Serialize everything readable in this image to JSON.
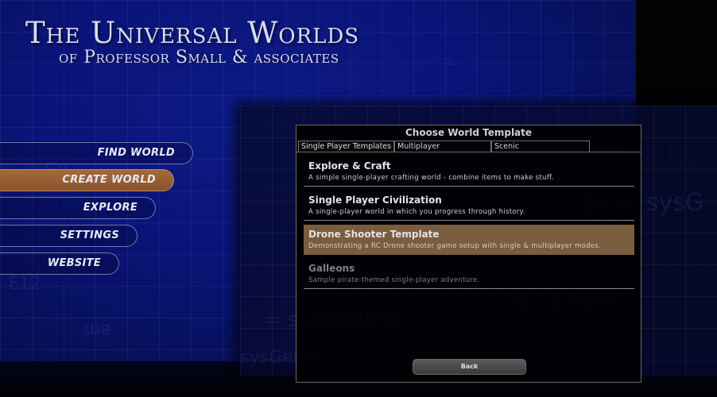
{
  "header": {
    "title_line1": "The Universal Worlds",
    "title_line2": "of Professor Small & associates"
  },
  "main_menu": {
    "items": [
      {
        "label": "FIND WORLD",
        "active": false
      },
      {
        "label": "CREATE WORLD",
        "active": true
      },
      {
        "label": "EXPLORE",
        "active": false
      },
      {
        "label": "SETTINGS",
        "active": false
      },
      {
        "label": "WEBSITE",
        "active": false
      }
    ]
  },
  "dialog": {
    "title": "Choose World Template",
    "tabs": [
      {
        "label": "Single Player Templates",
        "active": true
      },
      {
        "label": "Multiplayer",
        "active": false
      },
      {
        "label": "Scenic",
        "active": false
      }
    ],
    "templates": [
      {
        "title": "Explore & Craft",
        "description": "A simple single-player crafting world - combine items to make stuff.",
        "selected": false
      },
      {
        "title": "Single Player Civilization",
        "description": "A single-player world in which you progress through history.",
        "selected": false
      },
      {
        "title": "Drone Shooter Template",
        "description": "Demonstrating a RC Drone shooter game setup with single & multiplayer modes.",
        "selected": true
      },
      {
        "title": "Galleons",
        "description": "Sample pirate-themed single-player adventure.",
        "selected": false
      }
    ],
    "back_label": "Back"
  },
  "colors": {
    "background_blue": "#0a1478",
    "selected_accent": "#7a5c3e",
    "menu_active": "#9a603a"
  }
}
